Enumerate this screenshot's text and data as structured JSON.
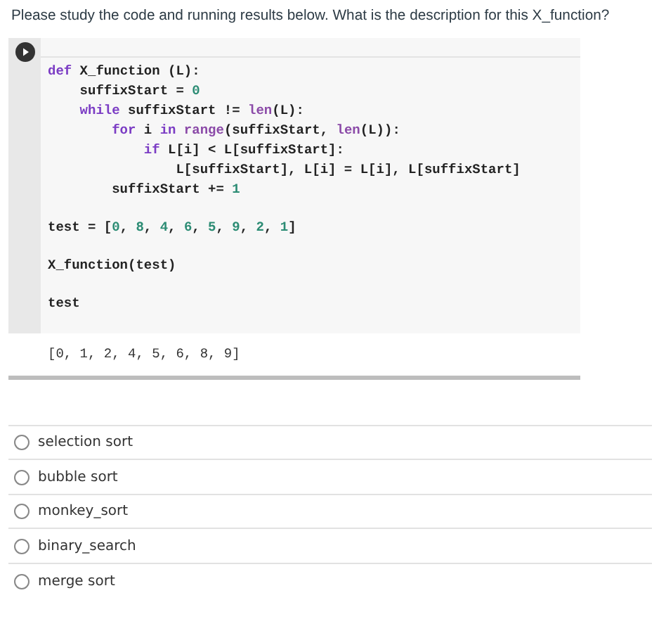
{
  "question": "Please study the code and running results below.  What is the description for this X_function?",
  "code_blocks": [
    [
      [
        {
          "kind": "keyword",
          "text": "def"
        },
        {
          "kind": "plain",
          "text": " X_function (L):"
        }
      ],
      [
        {
          "kind": "plain",
          "text": "    suffixStart = "
        },
        {
          "kind": "number",
          "text": "0"
        }
      ],
      [
        {
          "kind": "keyword",
          "text": "    while"
        },
        {
          "kind": "plain",
          "text": " suffixStart != "
        },
        {
          "kind": "builtin",
          "text": "len"
        },
        {
          "kind": "plain",
          "text": "(L):"
        }
      ],
      [
        {
          "kind": "keyword",
          "text": "        for"
        },
        {
          "kind": "plain",
          "text": " i "
        },
        {
          "kind": "keyword",
          "text": "in"
        },
        {
          "kind": "builtin",
          "text": " range"
        },
        {
          "kind": "plain",
          "text": "(suffixStart, "
        },
        {
          "kind": "builtin",
          "text": "len"
        },
        {
          "kind": "plain",
          "text": "(L)):"
        }
      ],
      [
        {
          "kind": "keyword",
          "text": "            if"
        },
        {
          "kind": "plain",
          "text": " L[i] < L[suffixStart]:"
        }
      ],
      [
        {
          "kind": "plain",
          "text": "                L[suffixStart], L[i] = L[i], L[suffixStart]"
        }
      ],
      [
        {
          "kind": "plain",
          "text": "        suffixStart += "
        },
        {
          "kind": "number",
          "text": "1"
        }
      ]
    ],
    [
      [
        {
          "kind": "plain",
          "text": "test = ["
        },
        {
          "kind": "number",
          "text": "0"
        },
        {
          "kind": "plain",
          "text": ", "
        },
        {
          "kind": "number",
          "text": "8"
        },
        {
          "kind": "plain",
          "text": ", "
        },
        {
          "kind": "number",
          "text": "4"
        },
        {
          "kind": "plain",
          "text": ", "
        },
        {
          "kind": "number",
          "text": "6"
        },
        {
          "kind": "plain",
          "text": ", "
        },
        {
          "kind": "number",
          "text": "5"
        },
        {
          "kind": "plain",
          "text": ", "
        },
        {
          "kind": "number",
          "text": "9"
        },
        {
          "kind": "plain",
          "text": ", "
        },
        {
          "kind": "number",
          "text": "2"
        },
        {
          "kind": "plain",
          "text": ", "
        },
        {
          "kind": "number",
          "text": "1"
        },
        {
          "kind": "plain",
          "text": "]"
        }
      ]
    ],
    [
      [
        {
          "kind": "plain",
          "text": "X_function(test)"
        }
      ]
    ],
    [
      [
        {
          "kind": "plain",
          "text": "test"
        }
      ]
    ]
  ],
  "output": "[0, 1, 2, 4, 5, 6, 8, 9]",
  "options": [
    {
      "label": "selection sort",
      "selected": false
    },
    {
      "label": "bubble sort",
      "selected": false
    },
    {
      "label": "monkey_sort",
      "selected": false
    },
    {
      "label": "binary_search",
      "selected": false
    },
    {
      "label": "merge sort",
      "selected": false
    }
  ]
}
